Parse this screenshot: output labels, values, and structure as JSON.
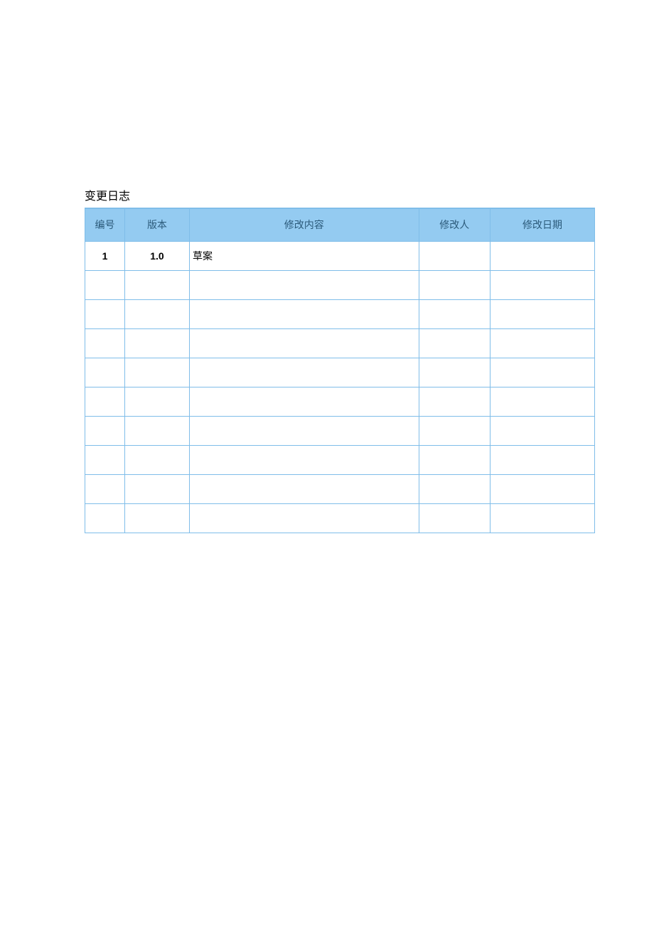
{
  "section_title": "变更日志",
  "table": {
    "headers": [
      "编号",
      "版本",
      "修改内容",
      "修改人",
      "修改日期"
    ],
    "rows": [
      {
        "id": "1",
        "version": "1.0",
        "content": "草案",
        "modifier": "",
        "date": ""
      },
      {
        "id": "",
        "version": "",
        "content": "",
        "modifier": "",
        "date": ""
      },
      {
        "id": "",
        "version": "",
        "content": "",
        "modifier": "",
        "date": ""
      },
      {
        "id": "",
        "version": "",
        "content": "",
        "modifier": "",
        "date": ""
      },
      {
        "id": "",
        "version": "",
        "content": "",
        "modifier": "",
        "date": ""
      },
      {
        "id": "",
        "version": "",
        "content": "",
        "modifier": "",
        "date": ""
      },
      {
        "id": "",
        "version": "",
        "content": "",
        "modifier": "",
        "date": ""
      },
      {
        "id": "",
        "version": "",
        "content": "",
        "modifier": "",
        "date": ""
      },
      {
        "id": "",
        "version": "",
        "content": "",
        "modifier": "",
        "date": ""
      },
      {
        "id": "",
        "version": "",
        "content": "",
        "modifier": "",
        "date": ""
      }
    ]
  }
}
